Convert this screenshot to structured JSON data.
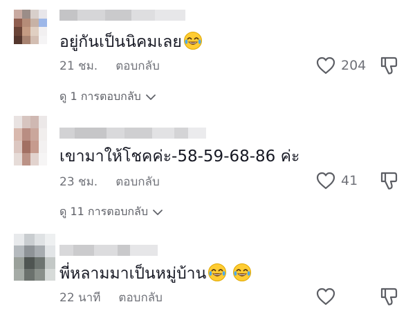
{
  "comments": [
    {
      "text": "อยู่กันเป็นนิคมเลย",
      "emoji": "face-with-tears-of-joy",
      "time": "21 ชม.",
      "reply_label": "ตอบกลับ",
      "likes": "204",
      "view_replies": "ดู 1 การตอบกลับ"
    },
    {
      "text": "เขามาให้โชคค่ะ-58-59-68-86 ค่ะ",
      "time": "23 ชม.",
      "reply_label": "ตอบกลับ",
      "likes": "41",
      "view_replies": "ดู 11 การตอบกลับ"
    },
    {
      "text": "พี่หลามมาเป็นหมู่บ้าน",
      "emoji": "face-with-tears-of-joy",
      "emoji_count": 2,
      "time": "22 นาที",
      "reply_label": "ตอบกลับ",
      "likes": ""
    }
  ],
  "colors": {
    "text_primary": "#161823",
    "text_secondary": "#6f7178",
    "icon_stroke": "#5b5d63",
    "emoji_face": "#ffcc33",
    "emoji_tear": "#4aa8e8"
  }
}
